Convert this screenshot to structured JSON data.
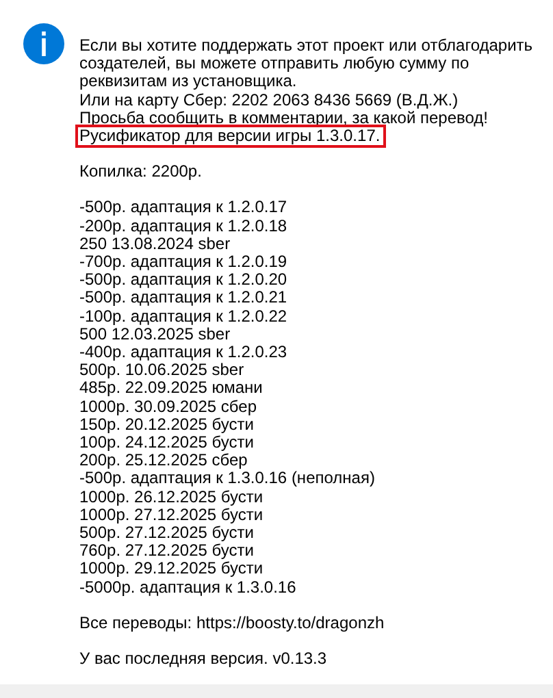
{
  "message": {
    "intro": [
      {
        "text": "Если вы хотите поддержать этот проект или отблагодарить",
        "highlighted": false
      },
      {
        "text": "создателей, вы можете отправить любую сумму по",
        "highlighted": false
      },
      {
        "text": "реквизитам из установщика.",
        "highlighted": false
      },
      {
        "text": "Или на карту Сбер: 2202 2063 8436 5669 (В.Д.Ж.)",
        "highlighted": false
      },
      {
        "text": "Просьба сообщить в комментарии, за какой перевод!",
        "highlighted": false
      },
      {
        "text": "Русификатор для версии игры 1.3.0.17.",
        "highlighted": true
      }
    ],
    "savings": "Копилка: 2200р.",
    "ledger": [
      "-500р. адаптация к 1.2.0.17",
      "-200р. адаптация к 1.2.0.18",
      "250 13.08.2024 sber",
      "-700р. адаптация к 1.2.0.19",
      "-500р. адаптация к 1.2.0.20",
      "-500р. адаптация к 1.2.0.21",
      "-100р. адаптация к 1.2.0.22",
      "500 12.03.2025 sber",
      "-400р. адаптация к 1.2.0.23",
      "500р. 10.06.2025 sber",
      "485р. 22.09.2025 юмани",
      "1000р. 30.09.2025 сбер",
      "150р. 20.12.2025 бусти",
      "100р. 24.12.2025 бусти",
      "200р. 25.12.2025 сбер",
      "-500р. адаптация к 1.3.0.16 (неполная)",
      "1000р. 26.12.2025 бусти",
      "1000р. 27.12.2025 бусти",
      "500р. 27.12.2025 бусти",
      "760р. 27.12.2025 бусти",
      "1000р. 29.12.2025 бусти",
      "-5000р. адаптация к 1.3.0.16"
    ],
    "all_transfers": "Все переводы: https://boosty.to/dragonzh",
    "version_status": "У вас последняя версия. v0.13.3"
  }
}
